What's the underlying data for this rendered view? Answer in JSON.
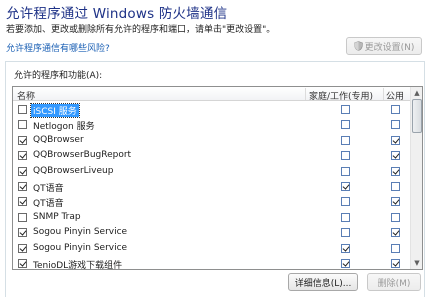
{
  "header": {
    "title": "允许程序通过 Windows 防火墙通信",
    "description": "若要添加、更改或删除所有允许的程序和端口，请单击\"更改设置\"。",
    "risk_link": "允许程序通信有哪些风险?",
    "change_settings_label": "更改设置(N)"
  },
  "programs": {
    "group_label": "允许的程序和功能(A):",
    "columns": {
      "name": "名称",
      "home": "家庭/工作(专用)",
      "public": "公用"
    },
    "rows": [
      {
        "name": "iSCSI 服务",
        "enabled": false,
        "home": false,
        "public": false,
        "selected": true
      },
      {
        "name": "Netlogon 服务",
        "enabled": false,
        "home": false,
        "public": false,
        "selected": false
      },
      {
        "name": "QQBrowser",
        "enabled": true,
        "home": false,
        "public": true,
        "selected": false
      },
      {
        "name": "QQBrowserBugReport",
        "enabled": true,
        "home": false,
        "public": true,
        "selected": false
      },
      {
        "name": "QQBrowserLiveup",
        "enabled": true,
        "home": false,
        "public": true,
        "selected": false
      },
      {
        "name": "QT语音",
        "enabled": true,
        "home": true,
        "public": false,
        "selected": false
      },
      {
        "name": "QT语音",
        "enabled": true,
        "home": false,
        "public": true,
        "selected": false
      },
      {
        "name": "SNMP Trap",
        "enabled": false,
        "home": false,
        "public": false,
        "selected": false
      },
      {
        "name": "Sogou Pinyin Service",
        "enabled": true,
        "home": false,
        "public": true,
        "selected": false
      },
      {
        "name": "Sogou Pinyin Service",
        "enabled": true,
        "home": true,
        "public": false,
        "selected": false
      },
      {
        "name": "TenioDL游戏下载组件",
        "enabled": true,
        "home": true,
        "public": true,
        "selected": false
      }
    ]
  },
  "footer": {
    "details_label": "详细信息(L)...",
    "delete_label": "删除(M)"
  }
}
